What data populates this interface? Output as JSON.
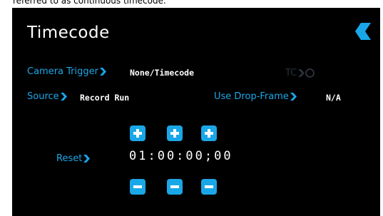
{
  "caption": "referred to as continuous timecode.",
  "title": "Timecode",
  "icons": {
    "back": "back-arrow-icon",
    "chevron": "chevron-right-icon",
    "plus": "plus-icon",
    "minus": "minus-icon"
  },
  "colors": {
    "accent": "#1aa7e8",
    "background": "#000000",
    "text": "#ffffff",
    "disabled": "#2a2f3a"
  },
  "camera_trigger": {
    "label": "Camera Trigger",
    "value": "None/Timecode"
  },
  "tc_indicator": {
    "label": "TC"
  },
  "source": {
    "label": "Source",
    "value": "Record Run"
  },
  "drop_frame": {
    "label": "Use Drop-Frame",
    "value": "N/A"
  },
  "reset": {
    "label": "Reset"
  },
  "timecode": {
    "value": "01:00:00;00"
  }
}
